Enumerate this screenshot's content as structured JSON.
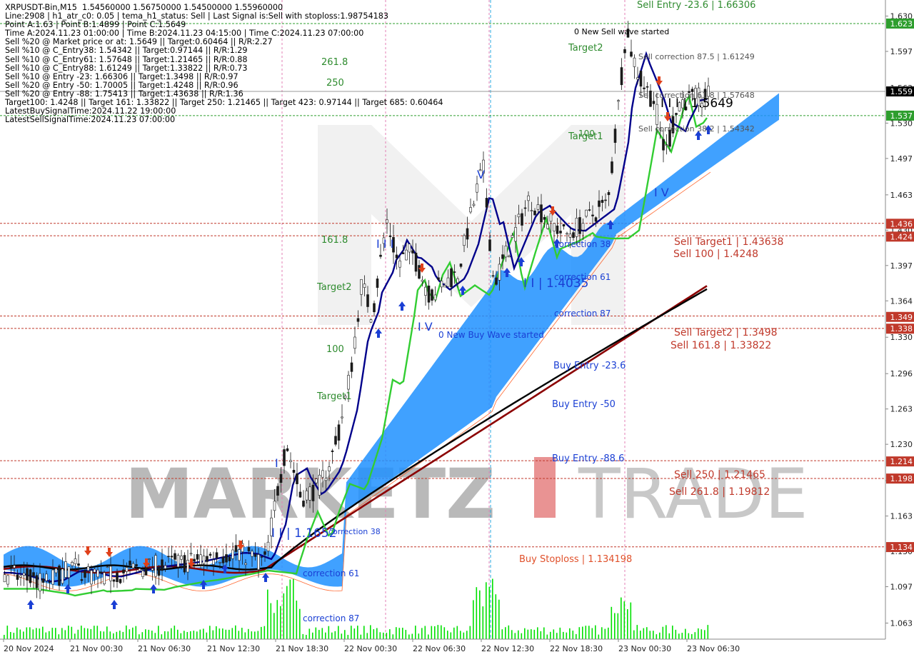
{
  "info_lines": [
    "XRPUSDT-Bin,M15  1.54560000 1.56750000 1.54500000 1.55960000",
    "Line:2908 | h1_atr_c0: 0.05 | tema_h1_status: Sell | Last Signal is:Sell with stoploss:1.98754183",
    "Point A:1.63 | Point B:1.4899 | Point C:1.5649",
    "Time A:2024.11.23 01:00:00 | Time B:2024.11.23 04:15:00 | Time C:2024.11.23 07:00:00",
    "Sell %20 @ Market price or at: 1.5649 || Target:0.60464 || R/R:2.27",
    "Sell %10 @ C_Entry38: 1.54342 || Target:0.97144 || R/R:1.29",
    "Sell %10 @ C_Entry61: 1.57648 || Target:1.21465 || R/R:0.88",
    "Sell %10 @ C_Entry88: 1.61249 || Target:1.33822 || R/R:0.73",
    "Sell %10 @ Entry -23: 1.66306 || Target:1.3498 || R/R:0.97",
    "Sell %20 @ Entry -50: 1.70005 || Target:1.4248 || R/R:0.96",
    "Sell %20 @ Entry -88: 1.75413 || Target:1.43638 || R/R:1.36",
    "Target100: 1.4248 || Target 161: 1.33822 || Target 250: 1.21465 || Target 423: 0.97144 || Target 685: 0.60464",
    "LatestBuySignalTime:2024.11.22 19:00:00",
    "LatestSellSignalTime:2024.11.23 07:00:00"
  ],
  "watermark": "MARKETZITRADE",
  "colors": {
    "background": "#ffffff",
    "bull": "#1e8c1e",
    "bear": "#1e8c1e",
    "cloud_fill": "#1e90ff",
    "cloud_edge": "#ff4500",
    "ma_fast": "#00008b",
    "ma_mid": "#32cd32",
    "ma_slow": "#000000",
    "ma_long": "#8b0000",
    "volume": "#00e000",
    "green_level": "#2e9e2e",
    "red_level": "#c0392b",
    "orange_text": "#e0502a",
    "blue_text": "#1a3fd4",
    "green_text": "#2e8b2e",
    "price_box": "#000000"
  },
  "chart_data": {
    "type": "candlestick",
    "symbol": "XRPUSDT-Bin",
    "timeframe": "M15",
    "ohlc_last": {
      "open": 1.5456,
      "high": 1.5675,
      "low": 1.545,
      "close": 1.5596
    },
    "y_axis": {
      "range": [
        1.048,
        1.645
      ],
      "ticks": [
        1.63,
        1.597,
        1.563,
        1.53,
        1.497,
        1.463,
        1.43,
        1.397,
        1.364,
        1.33,
        1.296,
        1.263,
        1.23,
        1.196,
        1.163,
        1.13,
        1.097,
        1.063
      ],
      "tick_labels": [
        "1.630",
        "1.597",
        "1.563",
        "1.530",
        "1.497",
        "1.463",
        "1.430",
        "1.397",
        "1.364",
        "1.330",
        "1.296",
        "1.263",
        "1.230",
        "1.196",
        "1.163",
        "1.130",
        "1.097",
        "1.063"
      ]
    },
    "x_axis": {
      "tick_labels": [
        "20 Nov 2024",
        "21 Nov 00:30",
        "21 Nov 06:30",
        "21 Nov 12:30",
        "21 Nov 18:30",
        "22 Nov 00:30",
        "22 Nov 06:30",
        "22 Nov 12:30",
        "22 Nov 18:30",
        "23 Nov 00:30",
        "23 Nov 06:30"
      ]
    },
    "price_labels": [
      {
        "value": 1.623,
        "text": "1.623",
        "color": "#2e9e2e"
      },
      {
        "value": 1.5596,
        "text": "1.559",
        "color": "#000000"
      },
      {
        "value": 1.537,
        "text": "1.537",
        "color": "#2e9e2e"
      },
      {
        "value": 1.436,
        "text": "1.436",
        "color": "#c0392b"
      },
      {
        "value": 1.424,
        "text": "1.424",
        "color": "#c0392b"
      },
      {
        "value": 1.349,
        "text": "1.349",
        "color": "#c0392b"
      },
      {
        "value": 1.338,
        "text": "1.338",
        "color": "#c0392b"
      },
      {
        "value": 1.214,
        "text": "1.214",
        "color": "#c0392b"
      },
      {
        "value": 1.198,
        "text": "1.198",
        "color": "#c0392b"
      },
      {
        "value": 1.134,
        "text": "1.134",
        "color": "#c0392b"
      }
    ],
    "levels": [
      {
        "value": 1.623,
        "color": "#2e9e2e"
      },
      {
        "value": 1.537,
        "color": "#2e9e2e"
      },
      {
        "value": 1.43638,
        "color": "#c0392b"
      },
      {
        "value": 1.4248,
        "color": "#c0392b"
      },
      {
        "value": 1.3498,
        "color": "#c0392b"
      },
      {
        "value": 1.33822,
        "color": "#c0392b"
      },
      {
        "value": 1.21465,
        "color": "#c0392b"
      },
      {
        "value": 1.19812,
        "color": "#c0392b"
      },
      {
        "value": 1.134198,
        "color": "#c0392b"
      }
    ],
    "annotations": [
      {
        "text": "Sell Entry -23.6 | 1.66306",
        "color": "#2e8b2e"
      },
      {
        "text": "0 New Sell wave started",
        "color": "#000000"
      },
      {
        "text": "Target2",
        "color": "#2e8b2e"
      },
      {
        "text": "Sell correction 87.5 | 1.61249",
        "color": "#555555"
      },
      {
        "text": "Sell correction 61.8 | 1.57648",
        "color": "#555555"
      },
      {
        "text": "Sell correction 38.2 | 1.54342",
        "color": "#555555"
      },
      {
        "text": "I I I | 1.5649",
        "color": "#000000"
      },
      {
        "text": "100",
        "color": "#2e8b2e"
      },
      {
        "text": "Target1",
        "color": "#2e8b2e"
      },
      {
        "text": "I V",
        "color": "#1a3fd4"
      },
      {
        "text": "261.8",
        "color": "#2e8b2e"
      },
      {
        "text": "250",
        "color": "#2e8b2e"
      },
      {
        "text": "161.8",
        "color": "#2e8b2e"
      },
      {
        "text": "Target2",
        "color": "#2e8b2e"
      },
      {
        "text": "100",
        "color": "#2e8b2e"
      },
      {
        "text": "Target1",
        "color": "#2e8b2e"
      },
      {
        "text": "I I I",
        "color": "#1a3fd4"
      },
      {
        "text": "V",
        "color": "#1a3fd4"
      },
      {
        "text": "I V",
        "color": "#1a3fd4"
      },
      {
        "text": "0 New Buy Wave started",
        "color": "#1a3fd4"
      },
      {
        "text": "correction 38",
        "color": "#1a3fd4"
      },
      {
        "text": "correction 61",
        "color": "#1a3fd4"
      },
      {
        "text": "correction 87",
        "color": "#1a3fd4"
      },
      {
        "text": "I I | 1.4035",
        "color": "#1a3fd4"
      },
      {
        "text": "Buy Entry -23.6",
        "color": "#1a3fd4"
      },
      {
        "text": "Buy Entry -50",
        "color": "#1a3fd4"
      },
      {
        "text": "Buy Entry -88.6",
        "color": "#1a3fd4"
      },
      {
        "text": "Sell Target1 | 1.43638",
        "color": "#c0392b"
      },
      {
        "text": "Sell 100 | 1.4248",
        "color": "#c0392b"
      },
      {
        "text": "Sell Target2 | 1.3498",
        "color": "#c0392b"
      },
      {
        "text": "Sell 161.8 | 1.33822",
        "color": "#c0392b"
      },
      {
        "text": "Sell  250 | 1.21465",
        "color": "#c0392b"
      },
      {
        "text": "Sell  261.8 | 1.19812",
        "color": "#c0392b"
      },
      {
        "text": "Buy Stoploss | 1.134198",
        "color": "#e0502a"
      },
      {
        "text": "I",
        "color": "#1a3fd4"
      },
      {
        "text": "I I | 1.1652",
        "color": "#1a3fd4"
      },
      {
        "text": "correction 38",
        "color": "#1a3fd4"
      },
      {
        "text": "correction 61",
        "color": "#1a3fd4"
      },
      {
        "text": "correction 87",
        "color": "#1a3fd4"
      }
    ]
  }
}
